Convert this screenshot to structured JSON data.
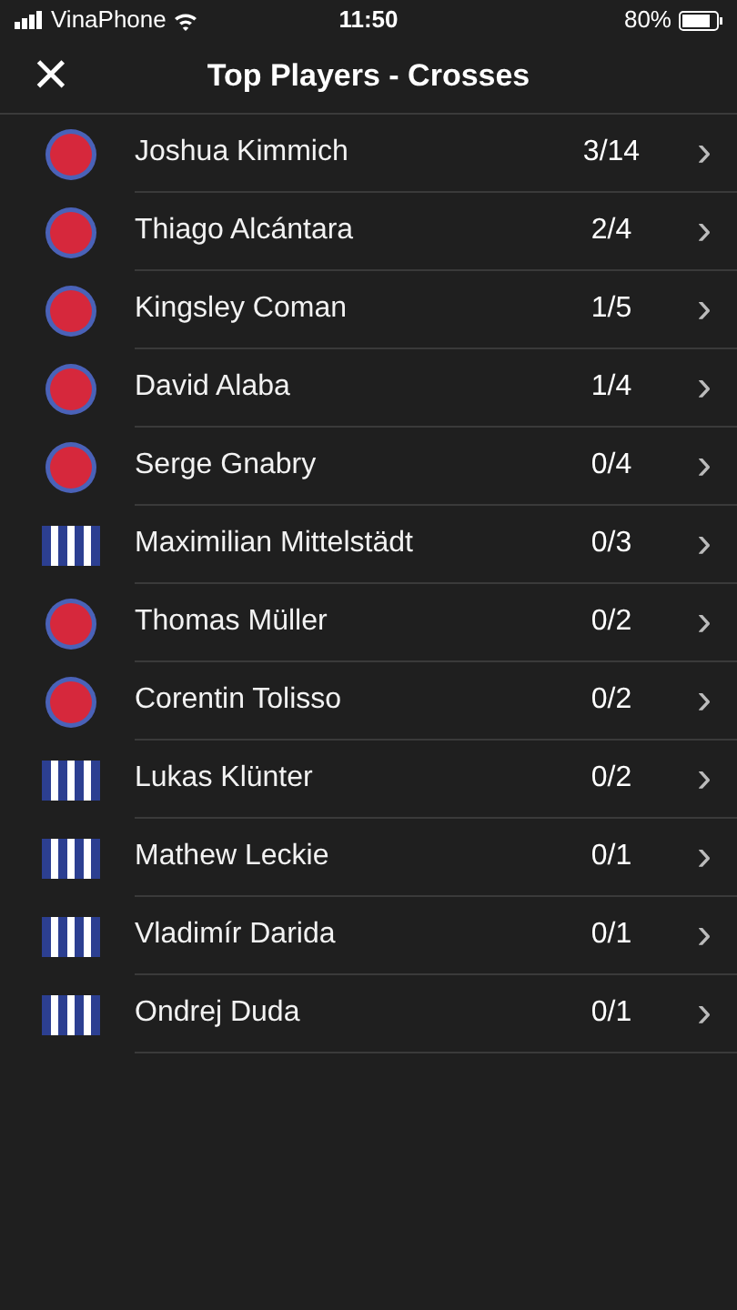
{
  "status_bar": {
    "carrier": "VinaPhone",
    "time": "11:50",
    "battery": "80%"
  },
  "header": {
    "close": "×",
    "title": "Top Players - Crosses"
  },
  "players": [
    {
      "kind": "round",
      "name": "Joshua Kimmich",
      "value": "3/14",
      "chevron": "›"
    },
    {
      "kind": "round",
      "name": "Thiago Alcántara",
      "value": "2/4",
      "chevron": "›"
    },
    {
      "kind": "round",
      "name": "Kingsley Coman",
      "value": "1/5",
      "chevron": "›"
    },
    {
      "kind": "round",
      "name": "David Alaba",
      "value": "1/4",
      "chevron": "›"
    },
    {
      "kind": "round",
      "name": "Serge Gnabry",
      "value": "0/4",
      "chevron": "›"
    },
    {
      "kind": "striped",
      "name": "Maximilian Mittelstädt",
      "value": "0/3",
      "chevron": "›"
    },
    {
      "kind": "round",
      "name": "Thomas Müller",
      "value": "0/2",
      "chevron": "›"
    },
    {
      "kind": "round",
      "name": "Corentin Tolisso",
      "value": "0/2",
      "chevron": "›"
    },
    {
      "kind": "striped",
      "name": "Lukas Klünter",
      "value": "0/2",
      "chevron": "›"
    },
    {
      "kind": "striped",
      "name": "Mathew Leckie",
      "value": "0/1",
      "chevron": "›"
    },
    {
      "kind": "striped",
      "name": "Vladimír Darida",
      "value": "0/1",
      "chevron": "›"
    },
    {
      "kind": "striped",
      "name": "Ondrej Duda",
      "value": "0/1",
      "chevron": "›"
    }
  ]
}
